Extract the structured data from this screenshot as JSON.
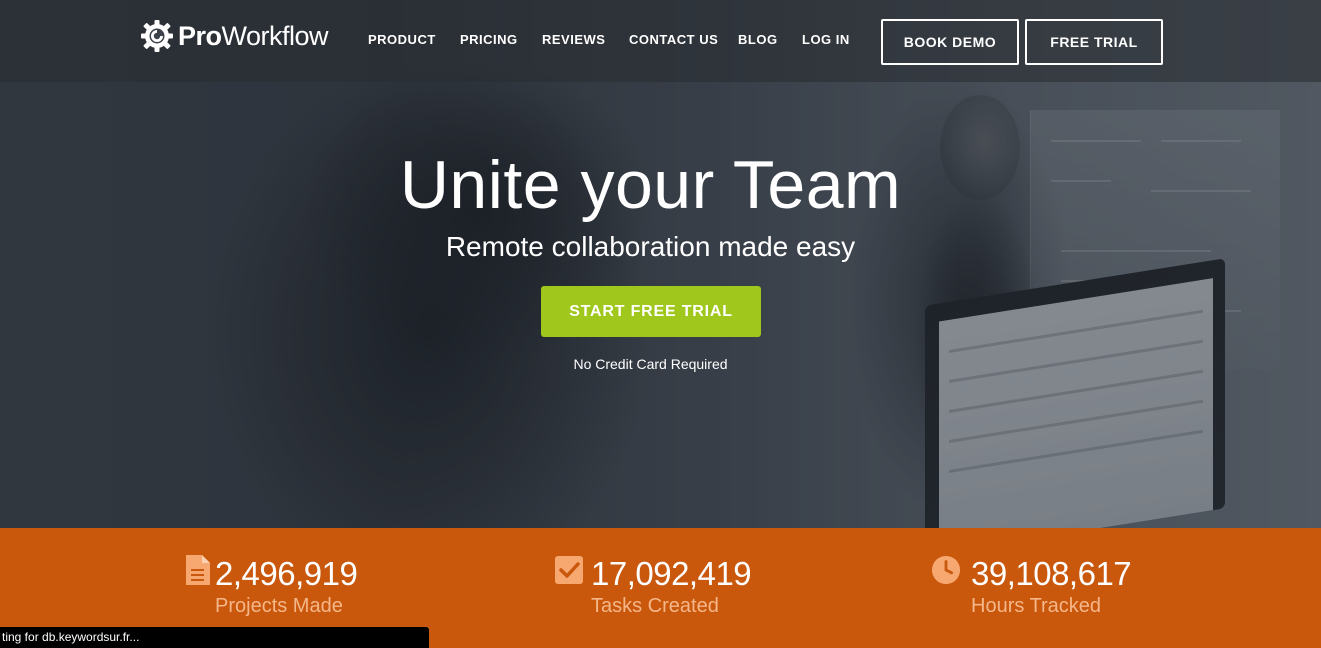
{
  "brand": {
    "pro": "Pro",
    "workflow": "Workflow"
  },
  "nav": {
    "items": [
      {
        "label": "PRODUCT"
      },
      {
        "label": "PRICING"
      },
      {
        "label": "REVIEWS"
      },
      {
        "label": "CONTACT US"
      },
      {
        "label": "BLOG"
      },
      {
        "label": "LOG IN"
      }
    ],
    "book_demo": "BOOK DEMO",
    "free_trial": "FREE TRIAL"
  },
  "hero": {
    "title": "Unite your Team",
    "subtitle": "Remote collaboration made easy",
    "cta": "START FREE TRIAL",
    "note": "No Credit Card Required"
  },
  "stats": [
    {
      "icon": "document-icon",
      "value": "2,496,919",
      "label": "Projects Made"
    },
    {
      "icon": "checkbox-icon",
      "value": "17,092,419",
      "label": "Tasks Created"
    },
    {
      "icon": "clock-icon",
      "value": "39,108,617",
      "label": "Hours Tracked"
    }
  ],
  "status_bar": {
    "text": "ting for db.keywordsur.fr..."
  },
  "colors": {
    "accent_green": "#9fc71c",
    "stats_orange": "#c9570c",
    "stats_label": "#f5b789",
    "icon_orange": "#f6a870"
  }
}
